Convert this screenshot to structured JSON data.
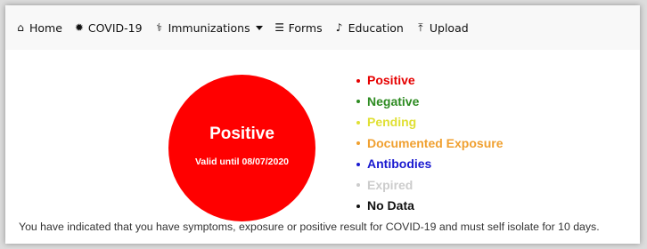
{
  "nav": {
    "items": [
      {
        "label": "Home",
        "icon": "home-icon",
        "glyph": "⌂"
      },
      {
        "label": "COVID-19",
        "icon": "virus-icon",
        "glyph": "✹"
      },
      {
        "label": "Immunizations",
        "icon": "stethoscope-icon",
        "glyph": "⚕",
        "has_dropdown": true
      },
      {
        "label": "Forms",
        "icon": "list-icon",
        "glyph": "☰"
      },
      {
        "label": "Education",
        "icon": "bell-icon",
        "glyph": "♪"
      },
      {
        "label": "Upload",
        "icon": "upload-icon",
        "glyph": "⤒"
      }
    ]
  },
  "status": {
    "title": "Positive",
    "valid_text": "Valid until 08/07/2020",
    "color": "#ff0000"
  },
  "legend": [
    {
      "label": "Positive",
      "color": "#e60000"
    },
    {
      "label": "Negative",
      "color": "#2e8b22"
    },
    {
      "label": "Pending",
      "color": "#e0e035"
    },
    {
      "label": "Documented Exposure",
      "color": "#f0a030"
    },
    {
      "label": "Antibodies",
      "color": "#1a1ad0"
    },
    {
      "label": "Expired",
      "color": "#cccccc"
    },
    {
      "label": "No Data",
      "color": "#111111"
    }
  ],
  "notice": "You have indicated that you have symptoms, exposure or positive result for COVID-19 and must self isolate for 10 days."
}
